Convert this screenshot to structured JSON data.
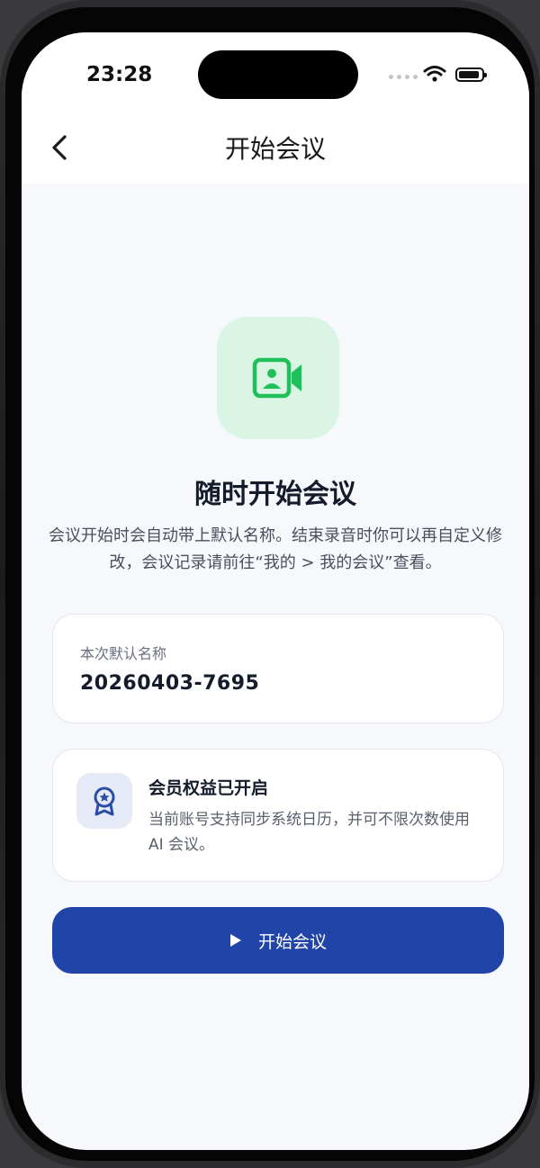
{
  "status_bar": {
    "time": "23:28"
  },
  "nav": {
    "title": "开始会议"
  },
  "hero": {
    "heading": "随时开始会议",
    "description": "会议开始时会自动带上默认名称。结束录音时你可以再自定义修改，会议记录请前往“我的 > 我的会议”查看。"
  },
  "name_card": {
    "label": "本次默认名称",
    "value": "20260403-7695"
  },
  "member_card": {
    "title": "会员权益已开启",
    "description": "当前账号支持同步系统日历，并可不限次数使用 AI 会议。"
  },
  "actions": {
    "start_label": "开始会议"
  },
  "colors": {
    "accent": "#2044a8",
    "hero_bg": "#dbf5e4",
    "hero_icon": "#1fbf5b",
    "badge_icon": "#2b4fa8"
  },
  "icons": [
    "back-chevron-icon",
    "video-camera-icon",
    "medal-star-icon",
    "play-icon",
    "wifi-icon",
    "battery-icon"
  ]
}
